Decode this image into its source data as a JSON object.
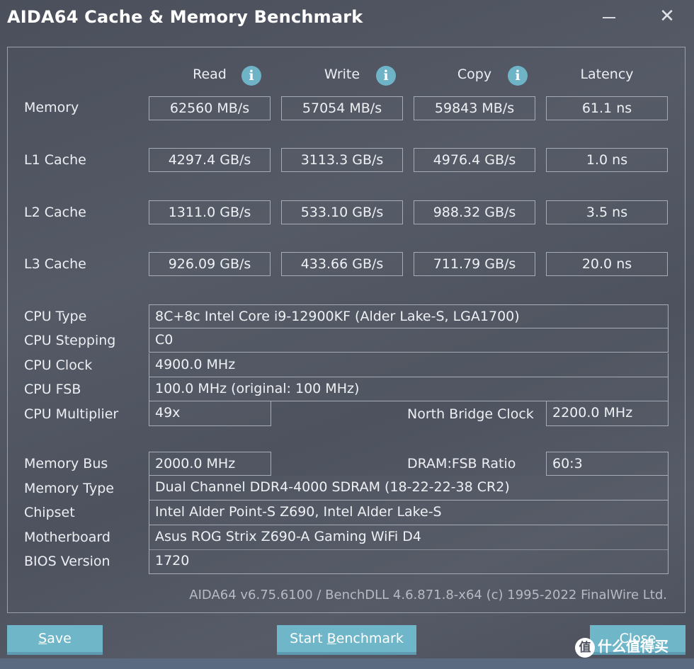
{
  "window": {
    "title": "AIDA64 Cache & Memory Benchmark",
    "minimize_icon": "minimize-icon",
    "close_icon": "close-icon"
  },
  "columns": [
    {
      "label": "Read",
      "has_info": true
    },
    {
      "label": "Write",
      "has_info": true
    },
    {
      "label": "Copy",
      "has_info": true
    },
    {
      "label": "Latency",
      "has_info": false
    }
  ],
  "info_glyph": "i",
  "benchmarks": [
    {
      "label": "Memory",
      "read": "62560 MB/s",
      "write": "57054 MB/s",
      "copy": "59843 MB/s",
      "latency": "61.1 ns"
    },
    {
      "label": "L1 Cache",
      "read": "4297.4 GB/s",
      "write": "3113.3 GB/s",
      "copy": "4976.4 GB/s",
      "latency": "1.0 ns"
    },
    {
      "label": "L2 Cache",
      "read": "1311.0 GB/s",
      "write": "533.10 GB/s",
      "copy": "988.32 GB/s",
      "latency": "3.5 ns"
    },
    {
      "label": "L3 Cache",
      "read": "926.09 GB/s",
      "write": "433.66 GB/s",
      "copy": "711.79 GB/s",
      "latency": "20.0 ns"
    }
  ],
  "cpu": {
    "type_label": "CPU Type",
    "type_value": "8C+8c Intel Core i9-12900KF  (Alder Lake-S, LGA1700)",
    "stepping_label": "CPU Stepping",
    "stepping_value": "C0",
    "clock_label": "CPU Clock",
    "clock_value": "4900.0 MHz",
    "fsb_label": "CPU FSB",
    "fsb_value": "100.0 MHz  (original: 100 MHz)",
    "multiplier_label": "CPU Multiplier",
    "multiplier_value": "49x",
    "nb_clock_label": "North Bridge Clock",
    "nb_clock_value": "2200.0 MHz"
  },
  "memory": {
    "bus_label": "Memory Bus",
    "bus_value": "2000.0 MHz",
    "ratio_label": "DRAM:FSB Ratio",
    "ratio_value": "60:3",
    "type_label": "Memory Type",
    "type_value": "Dual Channel DDR4-4000 SDRAM  (18-22-22-38 CR2)",
    "chipset_label": "Chipset",
    "chipset_value": "Intel Alder Point-S Z690, Intel Alder Lake-S",
    "motherboard_label": "Motherboard",
    "motherboard_value": "Asus ROG Strix Z690-A Gaming WiFi D4",
    "bios_label": "BIOS Version",
    "bios_value": "1720"
  },
  "footer": "AIDA64 v6.75.6100 / BenchDLL 4.6.871.8-x64  (c) 1995-2022 FinalWire Ltd.",
  "buttons": {
    "save_mnemonic": "S",
    "save_rest": "ave",
    "start_pre": "Start ",
    "start_mnemonic": "B",
    "start_rest": "enchmark",
    "close_label": "Close"
  },
  "watermark": {
    "logo": "值",
    "text": "什么值得买"
  }
}
